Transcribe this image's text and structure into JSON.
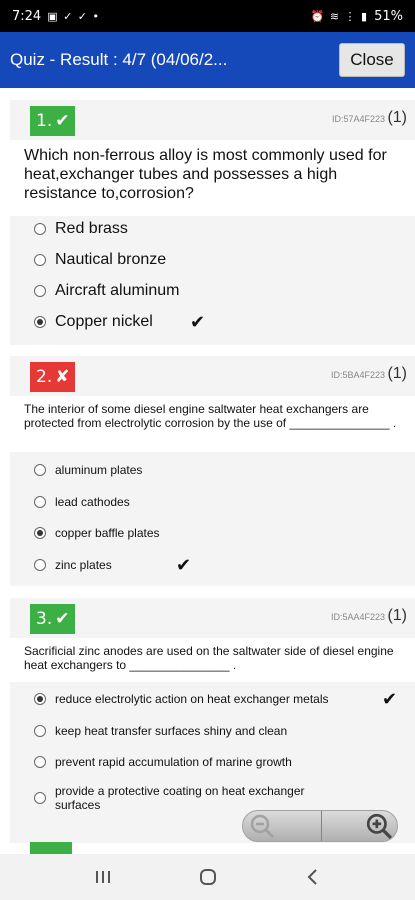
{
  "status_bar": {
    "time": "7:24",
    "left_icons": "▣ ✓ ✓ •",
    "right_icons": "⏰ ≋ ⋮ ▮",
    "battery": "51%"
  },
  "header": {
    "title": "Quiz - Result : 4/7 (04/06/2...",
    "close_label": "Close"
  },
  "questions": [
    {
      "number": "1.",
      "status": "correct",
      "status_mark": "✔",
      "id": "ID:57A4F223",
      "count": "(1)",
      "text": "Which non-ferrous alloy is most commonly used for heat,exchanger tubes and possesses a high resistance to,corrosion?",
      "options": [
        {
          "label": "Red brass",
          "selected": false,
          "correct": false
        },
        {
          "label": "Nautical bronze",
          "selected": false,
          "correct": false
        },
        {
          "label": "Aircraft aluminum",
          "selected": false,
          "correct": false
        },
        {
          "label": "Copper nickel",
          "selected": true,
          "correct": true
        }
      ]
    },
    {
      "number": "2.",
      "status": "wrong",
      "status_mark": "✘",
      "id": "ID:5BA4F223",
      "count": "(1)",
      "text": "The interior of some diesel engine saltwater heat exchangers are protected from electrolytic corrosion by the use of _______________ .",
      "options": [
        {
          "label": "aluminum plates",
          "selected": false,
          "correct": false
        },
        {
          "label": "lead cathodes",
          "selected": false,
          "correct": false
        },
        {
          "label": "copper baffle plates",
          "selected": true,
          "correct": false
        },
        {
          "label": "zinc plates",
          "selected": false,
          "correct": true
        }
      ]
    },
    {
      "number": "3.",
      "status": "correct",
      "status_mark": "✔",
      "id": "ID:5AA4F223",
      "count": "(1)",
      "text": "Sacrificial zinc anodes are used on the saltwater side of diesel engine heat exchangers to _______________ .",
      "options": [
        {
          "label": "reduce electrolytic action on heat exchanger metals",
          "selected": true,
          "correct": true
        },
        {
          "label": "keep heat transfer surfaces shiny and clean",
          "selected": false,
          "correct": false
        },
        {
          "label": "prevent rapid accumulation of marine growth",
          "selected": false,
          "correct": false
        },
        {
          "label": "provide a protective coating on heat exchanger surfaces",
          "selected": false,
          "correct": false
        }
      ]
    }
  ],
  "correct_check": "✔",
  "zoom": {
    "out_icon": "zoom-out-icon",
    "in_icon": "zoom-in-icon"
  },
  "colors": {
    "header": "#1548b8",
    "correct": "#3cb044",
    "wrong": "#e53935"
  }
}
